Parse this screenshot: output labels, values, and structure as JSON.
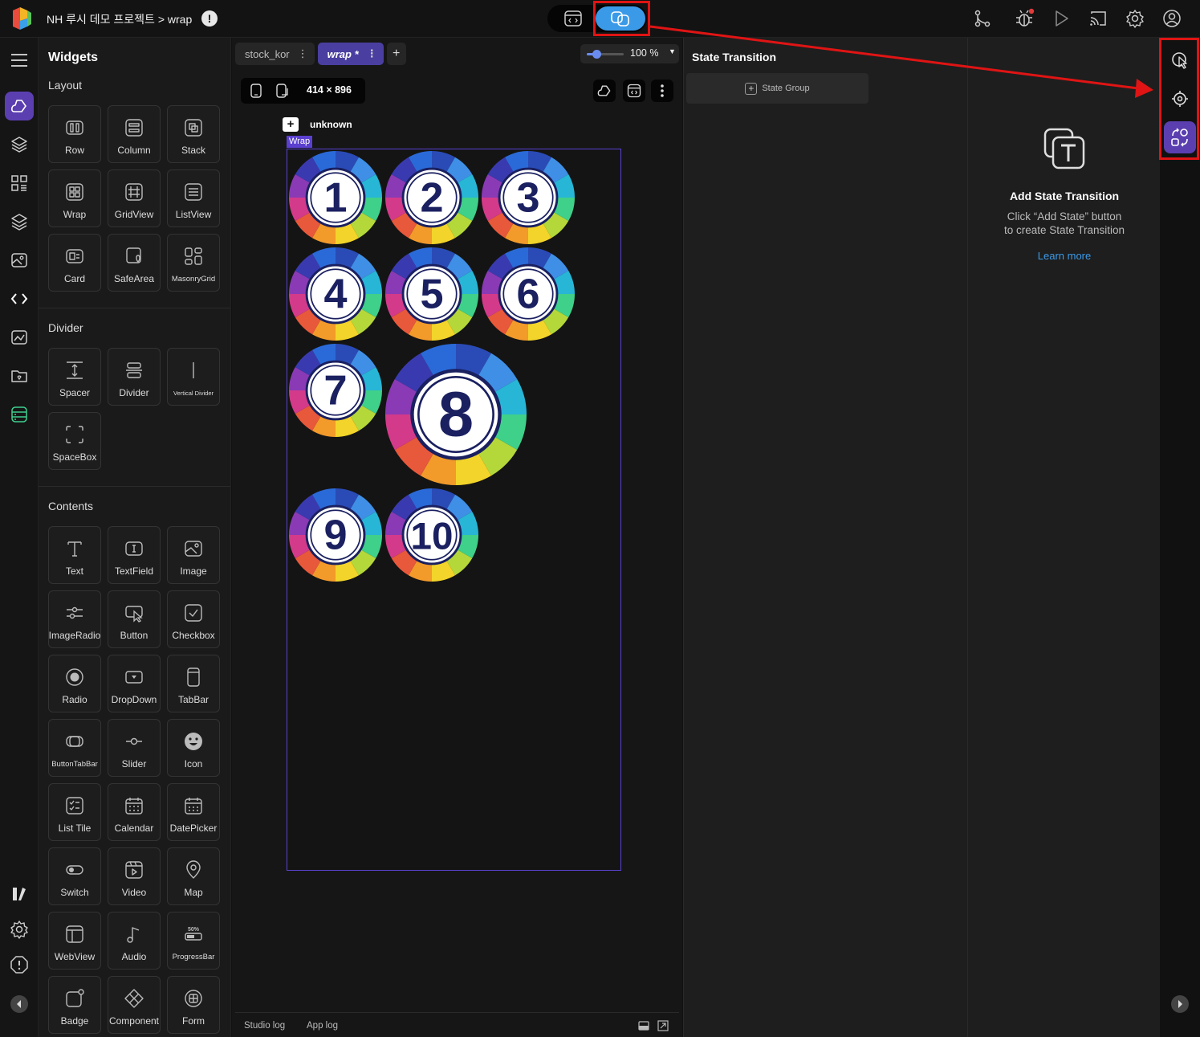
{
  "header": {
    "title": "NH 루시 데모 프로젝트 > wrap",
    "warning": "!",
    "mode_toggle": {
      "design": "design-mode",
      "state": "state-transition-mode",
      "active": "state"
    },
    "tools": [
      "branch-icon",
      "bug-icon",
      "play-icon",
      "cast-icon",
      "gear-icon",
      "account-icon"
    ],
    "accent": "#3b9ae8",
    "highlight_color": "#e01414"
  },
  "left_rail": {
    "items": [
      "menu-icon",
      "widget-icon",
      "layers-icon",
      "template-icon",
      "stack-icon",
      "image-icon",
      "code-icon",
      "asset-icon",
      "folder-icon",
      "api-icon"
    ],
    "bottom": [
      "library-icon",
      "settings-icon",
      "info-icon",
      "collapse-icon"
    ],
    "active": "widget-icon"
  },
  "widgets": {
    "title": "Widgets",
    "sections": [
      {
        "title": "Layout",
        "items": [
          {
            "label": "Row",
            "icon": "row-icon"
          },
          {
            "label": "Column",
            "icon": "column-icon"
          },
          {
            "label": "Stack",
            "icon": "stack-icon"
          },
          {
            "label": "Wrap",
            "icon": "wrap-icon"
          },
          {
            "label": "GridView",
            "icon": "grid-icon"
          },
          {
            "label": "ListView",
            "icon": "listview-icon"
          },
          {
            "label": "Card",
            "icon": "card-icon"
          },
          {
            "label": "SafeArea",
            "icon": "safearea-icon"
          },
          {
            "label": "MasonryGrid",
            "icon": "masonry-icon"
          }
        ]
      },
      {
        "title": "Divider",
        "items": [
          {
            "label": "Spacer",
            "icon": "spacer-icon"
          },
          {
            "label": "Divider",
            "icon": "divider-icon"
          },
          {
            "label": "Vertical Divider",
            "icon": "vertical-divider-icon"
          },
          {
            "label": "SpaceBox",
            "icon": "spacebox-icon"
          }
        ]
      },
      {
        "title": "Contents",
        "items": [
          {
            "label": "Text",
            "icon": "text-icon"
          },
          {
            "label": "TextField",
            "icon": "textfield-icon"
          },
          {
            "label": "Image",
            "icon": "image-icon"
          },
          {
            "label": "ImageRadio",
            "icon": "imageradio-icon"
          },
          {
            "label": "Button",
            "icon": "button-icon"
          },
          {
            "label": "Checkbox",
            "icon": "checkbox-icon"
          },
          {
            "label": "Radio",
            "icon": "radio-icon"
          },
          {
            "label": "DropDown",
            "icon": "dropdown-icon"
          },
          {
            "label": "TabBar",
            "icon": "tabbar-icon"
          },
          {
            "label": "ButtonTabBar",
            "icon": "buttontabbar-icon"
          },
          {
            "label": "Slider",
            "icon": "slider-icon"
          },
          {
            "label": "Icon",
            "icon": "smiley-icon"
          },
          {
            "label": "List Tile",
            "icon": "listtile-icon"
          },
          {
            "label": "Calendar",
            "icon": "calendar-icon"
          },
          {
            "label": "DatePicker",
            "icon": "datepicker-icon"
          },
          {
            "label": "Switch",
            "icon": "switch-icon"
          },
          {
            "label": "Video",
            "icon": "video-icon"
          },
          {
            "label": "Map",
            "icon": "map-pin-icon"
          },
          {
            "label": "WebView",
            "icon": "webview-icon"
          },
          {
            "label": "Audio",
            "icon": "audio-icon"
          },
          {
            "label": "ProgressBar",
            "icon": "progressbar-icon"
          },
          {
            "label": "Badge",
            "icon": "badge-icon"
          },
          {
            "label": "Component",
            "icon": "component-icon"
          },
          {
            "label": "Form",
            "icon": "form-icon"
          }
        ]
      }
    ]
  },
  "canvas": {
    "tabs": [
      {
        "label": "stock_kor",
        "active": false
      },
      {
        "label": "wrap *",
        "active": true
      }
    ],
    "zoom": {
      "label": "100 %",
      "fraction": 0.25
    },
    "device_size": "414 × 896",
    "page_name": "unknown",
    "wrap_tag": "Wrap",
    "balls": [
      "1",
      "2",
      "3",
      "4",
      "5",
      "6",
      "7",
      "8",
      "9",
      "10"
    ],
    "log_tabs": [
      "Studio log",
      "App log"
    ]
  },
  "state_panel": {
    "title": "State Transition",
    "group_button": "State Group"
  },
  "right_panel": {
    "title": "Add State Transition",
    "desc_line1": "Click “Add State” button",
    "desc_line2": "to create State Transition",
    "link": "Learn more"
  },
  "right_rail": {
    "items": [
      "touch-icon",
      "target-icon",
      "state-transition-icon"
    ],
    "active": "state-transition-icon"
  }
}
